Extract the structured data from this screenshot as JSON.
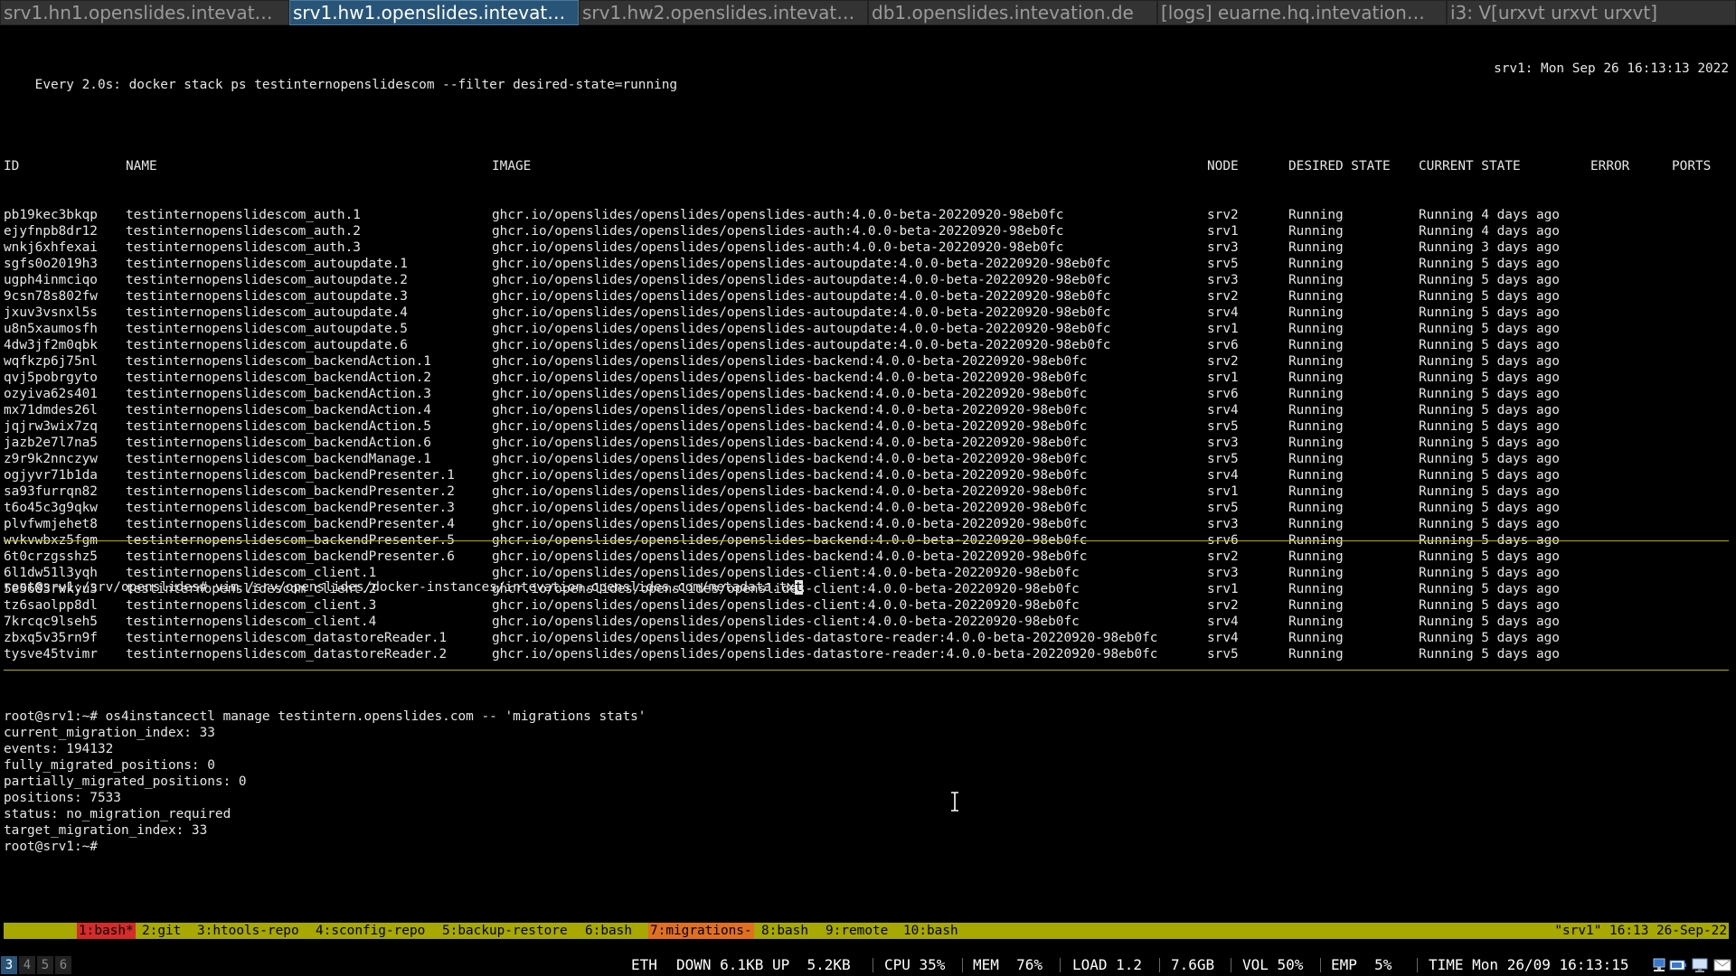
{
  "tabs": [
    {
      "label": "srv1.hn1.openslides.intevat…",
      "active": false
    },
    {
      "label": "srv1.hw1.openslides.intevat…",
      "active": true
    },
    {
      "label": "srv1.hw2.openslides.intevat…",
      "active": false
    },
    {
      "label": "db1.openslides.intevation.de",
      "active": false
    },
    {
      "label": "[logs] euarne.hq.intevation…",
      "active": false
    },
    {
      "label": "i3: V[urxvt urxvt urxvt]",
      "active": false
    }
  ],
  "watch": {
    "command": "Every 2.0s: docker stack ps testinternopenslidescom --filter desired-state=running",
    "host_time": "srv1: Mon Sep 26 16:13:13 2022",
    "headers": {
      "id": "ID",
      "name": "NAME",
      "image": "IMAGE",
      "node": "NODE",
      "desired": "DESIRED STATE",
      "current": "CURRENT STATE",
      "error": "ERROR",
      "ports": "PORTS"
    },
    "rows": [
      {
        "id": "pb19kec3bkqp",
        "name": "testinternopenslidescom_auth.1",
        "image": "ghcr.io/openslides/openslides/openslides-auth:4.0.0-beta-20220920-98eb0fc",
        "node": "srv2",
        "desired": "Running",
        "current": "Running 4 days ago"
      },
      {
        "id": "ejyfnpb8dr12",
        "name": "testinternopenslidescom_auth.2",
        "image": "ghcr.io/openslides/openslides/openslides-auth:4.0.0-beta-20220920-98eb0fc",
        "node": "srv1",
        "desired": "Running",
        "current": "Running 4 days ago"
      },
      {
        "id": "wnkj6xhfexai",
        "name": "testinternopenslidescom_auth.3",
        "image": "ghcr.io/openslides/openslides/openslides-auth:4.0.0-beta-20220920-98eb0fc",
        "node": "srv3",
        "desired": "Running",
        "current": "Running 3 days ago"
      },
      {
        "id": "sgfs0o2019h3",
        "name": "testinternopenslidescom_autoupdate.1",
        "image": "ghcr.io/openslides/openslides/openslides-autoupdate:4.0.0-beta-20220920-98eb0fc",
        "node": "srv5",
        "desired": "Running",
        "current": "Running 5 days ago"
      },
      {
        "id": "ugph4inmciqo",
        "name": "testinternopenslidescom_autoupdate.2",
        "image": "ghcr.io/openslides/openslides/openslides-autoupdate:4.0.0-beta-20220920-98eb0fc",
        "node": "srv3",
        "desired": "Running",
        "current": "Running 5 days ago"
      },
      {
        "id": "9csn78s802fw",
        "name": "testinternopenslidescom_autoupdate.3",
        "image": "ghcr.io/openslides/openslides/openslides-autoupdate:4.0.0-beta-20220920-98eb0fc",
        "node": "srv2",
        "desired": "Running",
        "current": "Running 5 days ago"
      },
      {
        "id": "jxuv3vsnxl5s",
        "name": "testinternopenslidescom_autoupdate.4",
        "image": "ghcr.io/openslides/openslides/openslides-autoupdate:4.0.0-beta-20220920-98eb0fc",
        "node": "srv4",
        "desired": "Running",
        "current": "Running 5 days ago"
      },
      {
        "id": "u8n5xaumosfh",
        "name": "testinternopenslidescom_autoupdate.5",
        "image": "ghcr.io/openslides/openslides/openslides-autoupdate:4.0.0-beta-20220920-98eb0fc",
        "node": "srv1",
        "desired": "Running",
        "current": "Running 5 days ago"
      },
      {
        "id": "4dw3jf2m0qbk",
        "name": "testinternopenslidescom_autoupdate.6",
        "image": "ghcr.io/openslides/openslides/openslides-autoupdate:4.0.0-beta-20220920-98eb0fc",
        "node": "srv6",
        "desired": "Running",
        "current": "Running 5 days ago"
      },
      {
        "id": "wqfkzp6j75nl",
        "name": "testinternopenslidescom_backendAction.1",
        "image": "ghcr.io/openslides/openslides/openslides-backend:4.0.0-beta-20220920-98eb0fc",
        "node": "srv2",
        "desired": "Running",
        "current": "Running 5 days ago"
      },
      {
        "id": "qvj5pobrgyto",
        "name": "testinternopenslidescom_backendAction.2",
        "image": "ghcr.io/openslides/openslides/openslides-backend:4.0.0-beta-20220920-98eb0fc",
        "node": "srv1",
        "desired": "Running",
        "current": "Running 5 days ago"
      },
      {
        "id": "ozyiva62s401",
        "name": "testinternopenslidescom_backendAction.3",
        "image": "ghcr.io/openslides/openslides/openslides-backend:4.0.0-beta-20220920-98eb0fc",
        "node": "srv6",
        "desired": "Running",
        "current": "Running 5 days ago"
      },
      {
        "id": "mx71dmdes26l",
        "name": "testinternopenslidescom_backendAction.4",
        "image": "ghcr.io/openslides/openslides/openslides-backend:4.0.0-beta-20220920-98eb0fc",
        "node": "srv4",
        "desired": "Running",
        "current": "Running 5 days ago"
      },
      {
        "id": "jqjrw3wix7zq",
        "name": "testinternopenslidescom_backendAction.5",
        "image": "ghcr.io/openslides/openslides/openslides-backend:4.0.0-beta-20220920-98eb0fc",
        "node": "srv5",
        "desired": "Running",
        "current": "Running 5 days ago"
      },
      {
        "id": "jazb2e7l7na5",
        "name": "testinternopenslidescom_backendAction.6",
        "image": "ghcr.io/openslides/openslides/openslides-backend:4.0.0-beta-20220920-98eb0fc",
        "node": "srv3",
        "desired": "Running",
        "current": "Running 5 days ago"
      },
      {
        "id": "z9r9k2nnczyw",
        "name": "testinternopenslidescom_backendManage.1",
        "image": "ghcr.io/openslides/openslides/openslides-backend:4.0.0-beta-20220920-98eb0fc",
        "node": "srv5",
        "desired": "Running",
        "current": "Running 5 days ago"
      },
      {
        "id": "ogjyvr71b1da",
        "name": "testinternopenslidescom_backendPresenter.1",
        "image": "ghcr.io/openslides/openslides/openslides-backend:4.0.0-beta-20220920-98eb0fc",
        "node": "srv4",
        "desired": "Running",
        "current": "Running 5 days ago"
      },
      {
        "id": "sa93furrqn82",
        "name": "testinternopenslidescom_backendPresenter.2",
        "image": "ghcr.io/openslides/openslides/openslides-backend:4.0.0-beta-20220920-98eb0fc",
        "node": "srv1",
        "desired": "Running",
        "current": "Running 5 days ago"
      },
      {
        "id": "t6o45c3g9qkw",
        "name": "testinternopenslidescom_backendPresenter.3",
        "image": "ghcr.io/openslides/openslides/openslides-backend:4.0.0-beta-20220920-98eb0fc",
        "node": "srv5",
        "desired": "Running",
        "current": "Running 5 days ago"
      },
      {
        "id": "plvfwmjehet8",
        "name": "testinternopenslidescom_backendPresenter.4",
        "image": "ghcr.io/openslides/openslides/openslides-backend:4.0.0-beta-20220920-98eb0fc",
        "node": "srv3",
        "desired": "Running",
        "current": "Running 5 days ago"
      },
      {
        "id": "wvkvwbxz5fgm",
        "name": "testinternopenslidescom_backendPresenter.5",
        "image": "ghcr.io/openslides/openslides/openslides-backend:4.0.0-beta-20220920-98eb0fc",
        "node": "srv6",
        "desired": "Running",
        "current": "Running 5 days ago"
      },
      {
        "id": "6t0crzgsshz5",
        "name": "testinternopenslidescom_backendPresenter.6",
        "image": "ghcr.io/openslides/openslides/openslides-backend:4.0.0-beta-20220920-98eb0fc",
        "node": "srv2",
        "desired": "Running",
        "current": "Running 5 days ago"
      },
      {
        "id": "6l1dw51l3yqh",
        "name": "testinternopenslidescom_client.1",
        "image": "ghcr.io/openslides/openslides/openslides-client:4.0.0-beta-20220920-98eb0fc",
        "node": "srv3",
        "desired": "Running",
        "current": "Running 5 days ago"
      },
      {
        "id": "5e5683rwkyu3",
        "name": "testinternopenslidescom_client.2",
        "image": "ghcr.io/openslides/openslides/openslides-client:4.0.0-beta-20220920-98eb0fc",
        "node": "srv1",
        "desired": "Running",
        "current": "Running 5 days ago"
      },
      {
        "id": "tz6saolpp8dl",
        "name": "testinternopenslidescom_client.3",
        "image": "ghcr.io/openslides/openslides/openslides-client:4.0.0-beta-20220920-98eb0fc",
        "node": "srv2",
        "desired": "Running",
        "current": "Running 5 days ago"
      },
      {
        "id": "7krcqc9lseh5",
        "name": "testinternopenslidescom_client.4",
        "image": "ghcr.io/openslides/openslides/openslides-client:4.0.0-beta-20220920-98eb0fc",
        "node": "srv4",
        "desired": "Running",
        "current": "Running 5 days ago"
      },
      {
        "id": "zbxq5v35rn9f",
        "name": "testinternopenslidescom_datastoreReader.1",
        "image": "ghcr.io/openslides/openslides/openslides-datastore-reader:4.0.0-beta-20220920-98eb0fc",
        "node": "srv4",
        "desired": "Running",
        "current": "Running 5 days ago"
      },
      {
        "id": "tysve45tvimr",
        "name": "testinternopenslidescom_datastoreReader.2",
        "image": "ghcr.io/openslides/openslides/openslides-datastore-reader:4.0.0-beta-20220920-98eb0fc",
        "node": "srv5",
        "desired": "Running",
        "current": "Running 5 days ago"
      }
    ]
  },
  "vim_pane": {
    "prompt_before_cursor": "root@srv1:/srv/openslides# vim /srv/openslides/docker-instances/intevation.openslides.com/metadata.tx",
    "cursor_char": "t"
  },
  "migrations_pane": {
    "lines": [
      "root@srv1:~# os4instancectl manage testintern.openslides.com -- 'migrations stats'",
      "current_migration_index: 33",
      "events: 194132",
      "fully_migrated_positions: 0",
      "partially_migrated_positions: 0",
      "positions: 7533",
      "status: no_migration_required",
      "target_migration_index: 33",
      "root@srv1:~#"
    ]
  },
  "tmux": {
    "windows": [
      {
        "label": "1:bash*",
        "state": "current"
      },
      {
        "label": "2:git",
        "state": "normal"
      },
      {
        "label": "3:htools-repo",
        "state": "normal"
      },
      {
        "label": "4:sconfig-repo",
        "state": "normal"
      },
      {
        "label": "5:backup-restore",
        "state": "normal"
      },
      {
        "label": "6:bash",
        "state": "normal"
      },
      {
        "label": "7:migrations-",
        "state": "alert"
      },
      {
        "label": "8:bash",
        "state": "normal"
      },
      {
        "label": "9:remote",
        "state": "normal"
      },
      {
        "label": "10:bash",
        "state": "normal"
      }
    ],
    "right": "\"srv1\" 16:13 26-Sep-22",
    "colors": {
      "bar": "#a7a800",
      "current": "#d52b2b",
      "alert": "#e07020"
    }
  },
  "i3bar": {
    "workspaces": [
      {
        "label": "3",
        "focused": true
      },
      {
        "label": "4",
        "focused": false
      },
      {
        "label": "5",
        "focused": false
      },
      {
        "label": "6",
        "focused": false
      }
    ],
    "status": {
      "eth": "ETH",
      "net": "DOWN 6.1KB UP  5.2KB",
      "cpu": "CPU 35%",
      "mem": "MEM  76%",
      "load": "LOAD 1.2",
      "disk": "7.6GB",
      "vol": "VOL 50%",
      "emp": "EMP  5%",
      "time": "TIME Mon 26/09 16:13:15"
    },
    "tray_icons": [
      "network-icon",
      "battery-icon",
      "monitor-icon",
      "mail-icon"
    ]
  }
}
